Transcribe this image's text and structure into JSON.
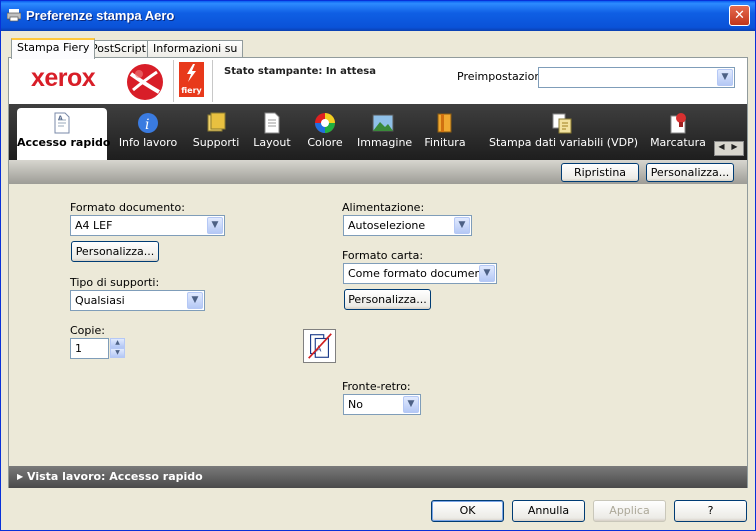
{
  "window": {
    "title": "Preferenze stampa Aero",
    "close_symbol": "✕"
  },
  "top_tabs": [
    "Stampa Fiery",
    "PostScript",
    "Informazioni su"
  ],
  "header": {
    "brand": "xerox",
    "fiery_text": "fiery",
    "printer_status": "Stato stampante: In attesa",
    "presets_label": "Preimpostazioni:",
    "presets_value": ""
  },
  "toolbar": {
    "tabs": [
      {
        "label": "Accesso rapido",
        "icon": "quick-access-icon"
      },
      {
        "label": "Info lavoro",
        "icon": "info-icon"
      },
      {
        "label": "Supporti",
        "icon": "media-icon"
      },
      {
        "label": "Layout",
        "icon": "layout-icon"
      },
      {
        "label": "Colore",
        "icon": "color-icon"
      },
      {
        "label": "Immagine",
        "icon": "image-icon"
      },
      {
        "label": "Finitura",
        "icon": "finishing-icon"
      },
      {
        "label": "Stampa dati variabili (VDP)",
        "icon": "vdp-icon"
      },
      {
        "label": "Marcatura",
        "icon": "stamping-icon"
      }
    ]
  },
  "subbar": {
    "reset": "Ripristina",
    "customize": "Personalizza..."
  },
  "form": {
    "doc_format_label": "Formato documento:",
    "doc_format_value": "A4 LEF",
    "doc_customize": "Personalizza...",
    "media_type_label": "Tipo di supporti:",
    "media_type_value": "Qualsiasi",
    "copies_label": "Copie:",
    "copies_value": "1",
    "feed_label": "Alimentazione:",
    "feed_value": "Autoselezione",
    "paper_format_label": "Formato carta:",
    "paper_format_value": "Come formato documento",
    "paper_customize": "Personalizza...",
    "duplex_label": "Fronte-retro:",
    "duplex_value": "No"
  },
  "job_view": "Vista lavoro: Accesso rapido",
  "dialog": {
    "ok": "OK",
    "cancel": "Annulla",
    "apply": "Applica",
    "help": "?"
  }
}
